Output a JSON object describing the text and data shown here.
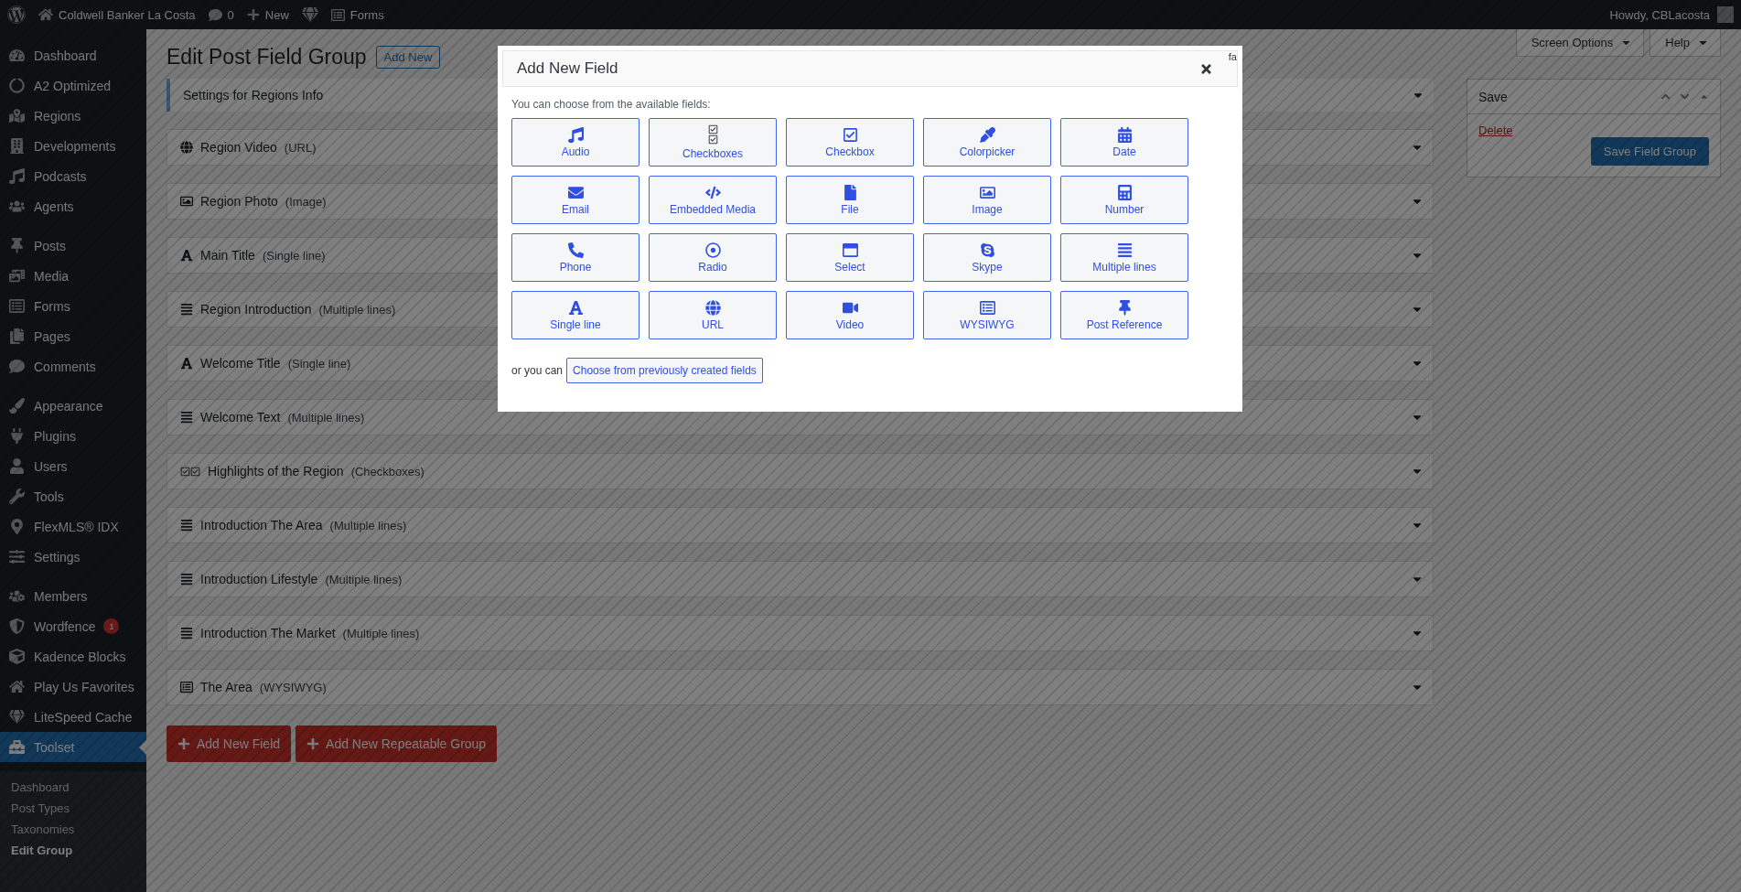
{
  "admin_bar": {
    "site_name": "Coldwell Banker La Costa",
    "comments": "0",
    "new": "New",
    "forms": "Forms",
    "greeting": "Howdy, CBLacosta"
  },
  "sidebar": {
    "groups": [
      {
        "items": [
          {
            "label": "Dashboard",
            "selected": false
          },
          {
            "label": "A2 Optimized",
            "selected": false
          },
          {
            "label": "Regions",
            "selected": false
          },
          {
            "label": "Developments",
            "selected": false
          },
          {
            "label": "Podcasts",
            "selected": false
          },
          {
            "label": "Agents",
            "selected": false
          }
        ]
      },
      {
        "items": [
          {
            "label": "Posts",
            "selected": false
          },
          {
            "label": "Media",
            "selected": false
          },
          {
            "label": "Forms",
            "selected": false
          },
          {
            "label": "Pages",
            "selected": false
          },
          {
            "label": "Comments",
            "selected": false
          }
        ]
      },
      {
        "items": [
          {
            "label": "Appearance",
            "selected": false
          },
          {
            "label": "Plugins",
            "selected": false
          },
          {
            "label": "Users",
            "selected": false
          },
          {
            "label": "Tools",
            "selected": false
          },
          {
            "label": "FlexMLS® IDX",
            "selected": false
          },
          {
            "label": "Settings",
            "selected": false
          }
        ]
      },
      {
        "items": [
          {
            "label": "Members",
            "selected": false
          },
          {
            "label": "Wordfence",
            "selected": false,
            "badge": "1"
          },
          {
            "label": "Kadence Blocks",
            "selected": false
          },
          {
            "label": "Play Us Favorites",
            "selected": false
          },
          {
            "label": "LiteSpeed Cache",
            "selected": false
          },
          {
            "label": "Toolset",
            "selected": true
          }
        ]
      }
    ],
    "submenu": [
      {
        "label": "Dashboard",
        "selected": false
      },
      {
        "label": "Post Types",
        "selected": false
      },
      {
        "label": "Taxonomies",
        "selected": false
      },
      {
        "label": "Edit Group",
        "selected": true
      }
    ]
  },
  "screen_meta": [
    "Screen Options",
    "Help"
  ],
  "page": {
    "title": "Edit Post Field Group",
    "add_new": "Add New",
    "settings_title": "Settings for Regions Info",
    "fields": [
      {
        "name": "Region Video",
        "type": "(URL)",
        "kind": "url"
      },
      {
        "name": "Region Photo",
        "type": "(Image)",
        "kind": "image"
      },
      {
        "name": "Main Title",
        "type": "(Single line)",
        "kind": "single"
      },
      {
        "name": "Region Introduction",
        "type": "(Multiple lines)",
        "kind": "multi"
      },
      {
        "name": "Welcome Title",
        "type": "(Single line)",
        "kind": "single"
      },
      {
        "name": "Welcome Text",
        "type": "(Multiple lines)",
        "kind": "multi"
      },
      {
        "name": "Highlights of the Region",
        "type": "(Checkboxes)",
        "kind": "checkboxes"
      },
      {
        "name": "Introduction The Area",
        "type": "(Multiple lines)",
        "kind": "multi"
      },
      {
        "name": "Introduction Lifestyle",
        "type": "(Multiple lines)",
        "kind": "multi"
      },
      {
        "name": "Introduction The Market",
        "type": "(Multiple lines)",
        "kind": "multi"
      },
      {
        "name": "The Area",
        "type": "(WYSIWYG)",
        "kind": "wysiwyg"
      }
    ],
    "buttons": [
      "Add New Field",
      "Add New Repeatable Group"
    ]
  },
  "save_box": {
    "title": "Save",
    "delete": "Delete",
    "button": "Save Field Group"
  },
  "dialog": {
    "title": "Add New Field",
    "corner_text": "fa",
    "intro": "You can choose from the available fields:",
    "field_types": [
      {
        "label": "Audio",
        "kind": "audio"
      },
      {
        "label": "Checkboxes",
        "kind": "checkboxes"
      },
      {
        "label": "Checkbox",
        "kind": "checkbox"
      },
      {
        "label": "Colorpicker",
        "kind": "colorpicker"
      },
      {
        "label": "Date",
        "kind": "date"
      },
      {
        "label": "Email",
        "kind": "email"
      },
      {
        "label": "Embedded Media",
        "kind": "embed"
      },
      {
        "label": "File",
        "kind": "file"
      },
      {
        "label": "Image",
        "kind": "image"
      },
      {
        "label": "Number",
        "kind": "number"
      },
      {
        "label": "Phone",
        "kind": "phone"
      },
      {
        "label": "Radio",
        "kind": "radio"
      },
      {
        "label": "Select",
        "kind": "select"
      },
      {
        "label": "Skype",
        "kind": "skype"
      },
      {
        "label": "Multiple lines",
        "kind": "multi"
      },
      {
        "label": "Single line",
        "kind": "single"
      },
      {
        "label": "URL",
        "kind": "url"
      },
      {
        "label": "Video",
        "kind": "video"
      },
      {
        "label": "WYSIWYG",
        "kind": "wysiwyg"
      },
      {
        "label": "Post Reference",
        "kind": "post"
      }
    ],
    "or_text": "or you can",
    "choose_button": "Choose from previously created fields"
  }
}
